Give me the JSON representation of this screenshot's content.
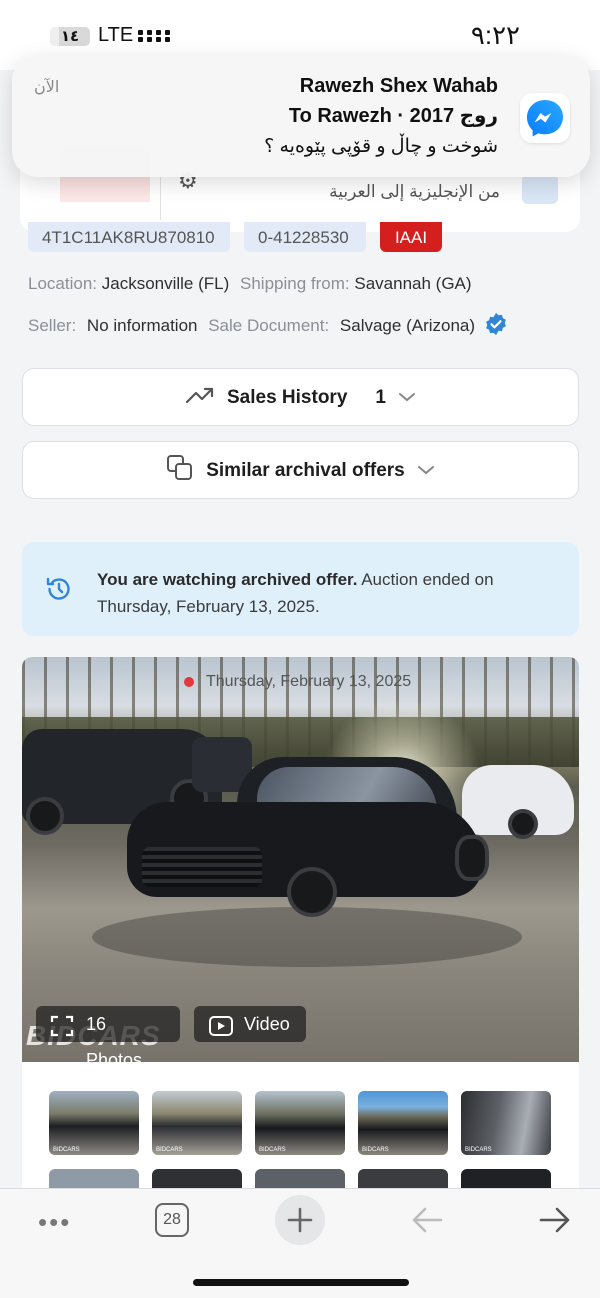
{
  "status_bar": {
    "battery": "١٤",
    "network": "LTE",
    "time": "٩:٢٢"
  },
  "notification": {
    "time": "الآن",
    "sender": "Rawezh Shex Wahab",
    "thread": "To Rawezh · 2017 روج",
    "message": "شوخت و چاڵ و قۆپی پێوەیە ؟",
    "app_icon": "messenger-icon"
  },
  "translate_bar": {
    "text": "من الإنجليزية إلى العربية"
  },
  "lot_tags": {
    "vin": "4T1C11AK8RU870810",
    "lot": "0-41228530",
    "source": "IAAI"
  },
  "details": {
    "location_label": "Location:",
    "location_value": "Jacksonville (FL)",
    "shipping_label": "Shipping from:",
    "shipping_value": "Savannah (GA)",
    "seller_label": "Seller:",
    "seller_value": "No information",
    "document_label": "Sale Document:",
    "document_value": "Salvage (Arizona)"
  },
  "sales_history": {
    "label": "Sales History",
    "count": "1"
  },
  "similar_offers": {
    "label": "Similar archival offers"
  },
  "notice": {
    "bold": "You are watching archived offer.",
    "text": " Auction ended on Thursday, February 13, 2025."
  },
  "gallery": {
    "date": "Thursday, February 13, 2025",
    "photos_label": "16 Photos",
    "video_label": "Video",
    "watermark": "BIDCARS"
  },
  "toolbar": {
    "more": "•••",
    "tab_count": "28"
  },
  "colors": {
    "accent_blue": "#2f86d8",
    "iaai_red": "#d51f1f",
    "notice_bg": "#dff0fb"
  }
}
